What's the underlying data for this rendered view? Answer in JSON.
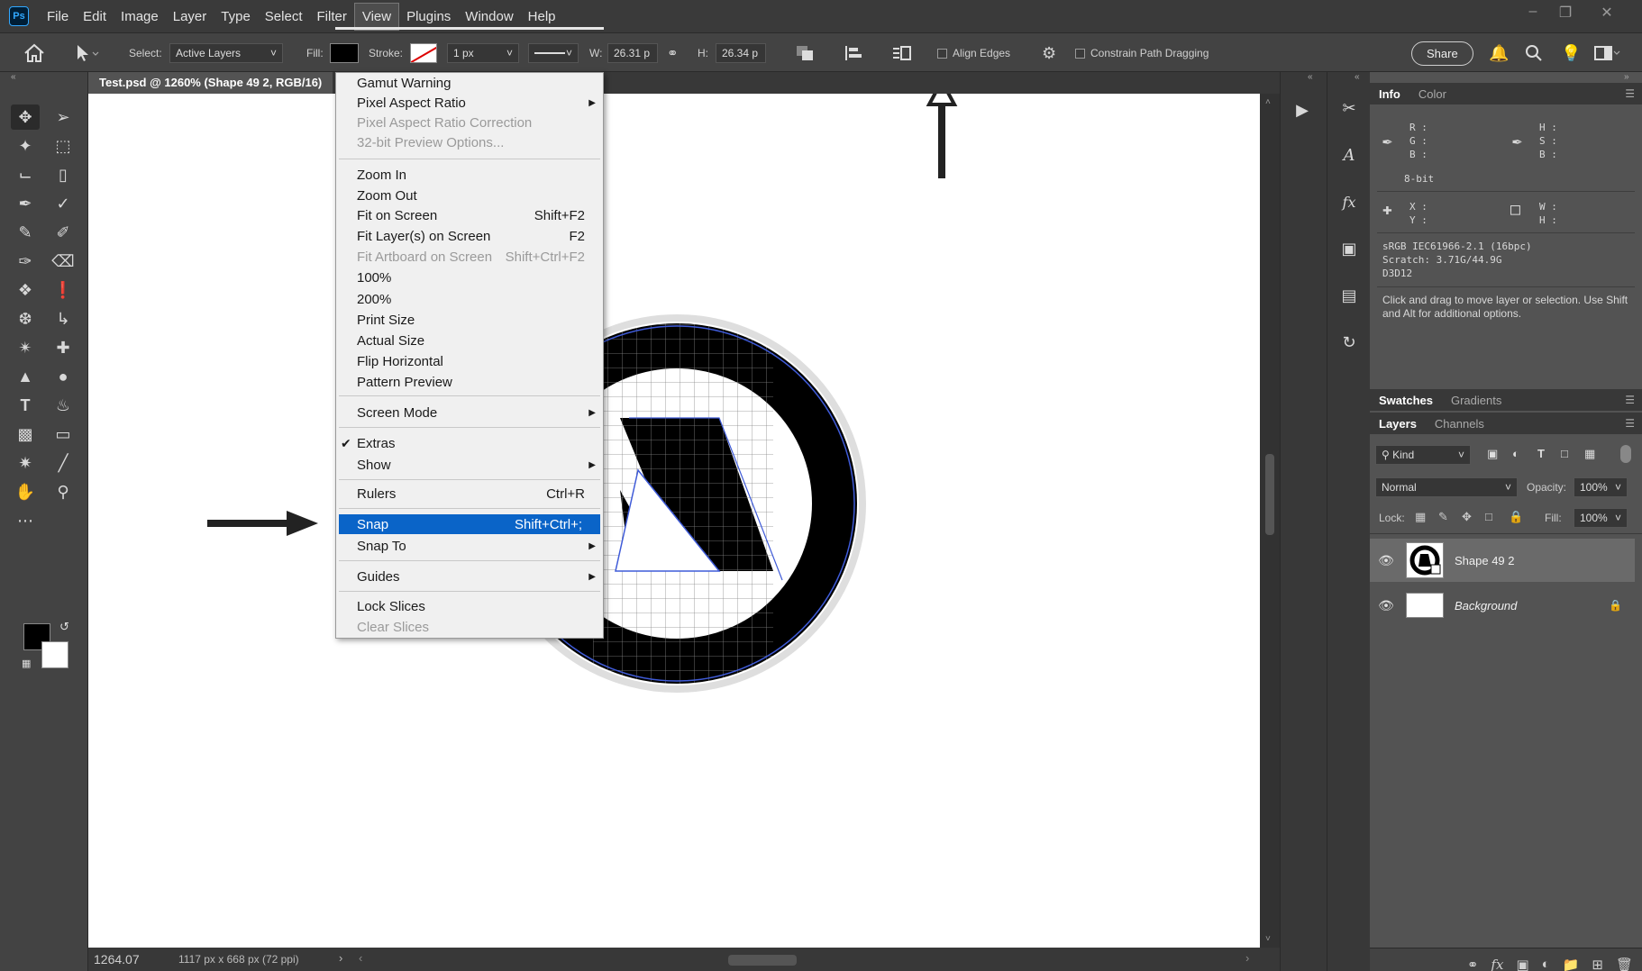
{
  "app": {
    "logo": "Ps",
    "menus": [
      "File",
      "Edit",
      "Image",
      "Layer",
      "Type",
      "Select",
      "Filter",
      "View",
      "Plugins",
      "Window",
      "Help"
    ],
    "active_menu": "View"
  },
  "options_bar": {
    "select_label": "Select:",
    "select_value": "Active Layers",
    "fill_label": "Fill:",
    "stroke_label": "Stroke:",
    "stroke_width": "1 px",
    "w_label": "W:",
    "w_value": "26.31 p",
    "h_label": "H:",
    "h_value": "26.34 p",
    "align_edges_label": "Align Edges",
    "align_edges_checked": false,
    "constrain_label": "Constrain Path Dragging",
    "constrain_checked": false,
    "share_label": "Share"
  },
  "document": {
    "tab_title": "Test.psd @ 1260% (Shape 49 2, RGB/16)",
    "zoom_value": "1264.07",
    "doc_size": "1117 px x 668 px (72 ppi)"
  },
  "view_menu": {
    "items": [
      {
        "label": "Gamut Warning",
        "shortcut": "",
        "disabled": false,
        "submenu": false
      },
      {
        "label": "Pixel Aspect Ratio",
        "shortcut": "",
        "disabled": false,
        "submenu": true
      },
      {
        "label": "Pixel Aspect Ratio Correction",
        "shortcut": "",
        "disabled": true,
        "submenu": false
      },
      {
        "label": "32-bit Preview Options...",
        "shortcut": "",
        "disabled": true,
        "submenu": false
      },
      {
        "label": "Zoom In",
        "shortcut": "",
        "disabled": false,
        "submenu": false
      },
      {
        "label": "Zoom Out",
        "shortcut": "",
        "disabled": false,
        "submenu": false
      },
      {
        "label": "Fit on Screen",
        "shortcut": "Shift+F2",
        "disabled": false,
        "submenu": false
      },
      {
        "label": "Fit Layer(s) on Screen",
        "shortcut": "F2",
        "disabled": false,
        "submenu": false
      },
      {
        "label": "Fit Artboard on Screen",
        "shortcut": "Shift+Ctrl+F2",
        "disabled": true,
        "submenu": false
      },
      {
        "label": "100%",
        "shortcut": "",
        "disabled": false,
        "submenu": false
      },
      {
        "label": "200%",
        "shortcut": "",
        "disabled": false,
        "submenu": false
      },
      {
        "label": "Print Size",
        "shortcut": "",
        "disabled": false,
        "submenu": false
      },
      {
        "label": "Actual Size",
        "shortcut": "",
        "disabled": false,
        "submenu": false
      },
      {
        "label": "Flip Horizontal",
        "shortcut": "",
        "disabled": false,
        "submenu": false
      },
      {
        "label": "Pattern Preview",
        "shortcut": "",
        "disabled": false,
        "submenu": false
      },
      {
        "label": "Screen Mode",
        "shortcut": "",
        "disabled": false,
        "submenu": true
      },
      {
        "label": "Extras",
        "shortcut": "",
        "disabled": false,
        "submenu": false,
        "checked": true
      },
      {
        "label": "Show",
        "shortcut": "",
        "disabled": false,
        "submenu": true
      },
      {
        "label": "Rulers",
        "shortcut": "Ctrl+R",
        "disabled": false,
        "submenu": false
      },
      {
        "label": "Snap",
        "shortcut": "Shift+Ctrl+;",
        "disabled": false,
        "submenu": false,
        "highlighted": true
      },
      {
        "label": "Snap To",
        "shortcut": "",
        "disabled": false,
        "submenu": true
      },
      {
        "label": "Guides",
        "shortcut": "",
        "disabled": false,
        "submenu": true
      },
      {
        "label": "Lock Slices",
        "shortcut": "",
        "disabled": false,
        "submenu": false
      },
      {
        "label": "Clear Slices",
        "shortcut": "",
        "disabled": true,
        "submenu": false
      }
    ]
  },
  "info_panel": {
    "tabs": [
      "Info",
      "Color"
    ],
    "rgb_labels": "R :\nG :\nB :",
    "hsb_labels": "H :\nS :\nB :",
    "bit_depth": "8-bit",
    "xy_labels": "X :\nY :",
    "wh_labels": "W :\nH :",
    "color_profile": "sRGB IEC61966-2.1 (16bpc)",
    "scratch": "Scratch: 3.71G/44.9G",
    "gpu": "D3D12",
    "hint": "Click and drag to move layer or selection.  Use Shift and Alt for additional options."
  },
  "swatches_tabs": [
    "Swatches",
    "Gradients"
  ],
  "layers_panel": {
    "tabs": [
      "Layers",
      "Channels"
    ],
    "filter_kind": "Kind",
    "blend_mode": "Normal",
    "opacity_label": "Opacity:",
    "opacity_value": "100%",
    "lock_label": "Lock:",
    "fill_label": "Fill:",
    "fill_value": "100%",
    "layers": [
      {
        "name": "Shape 49 2",
        "selected": true
      },
      {
        "name": "Background",
        "selected": false,
        "locked": true
      }
    ]
  }
}
